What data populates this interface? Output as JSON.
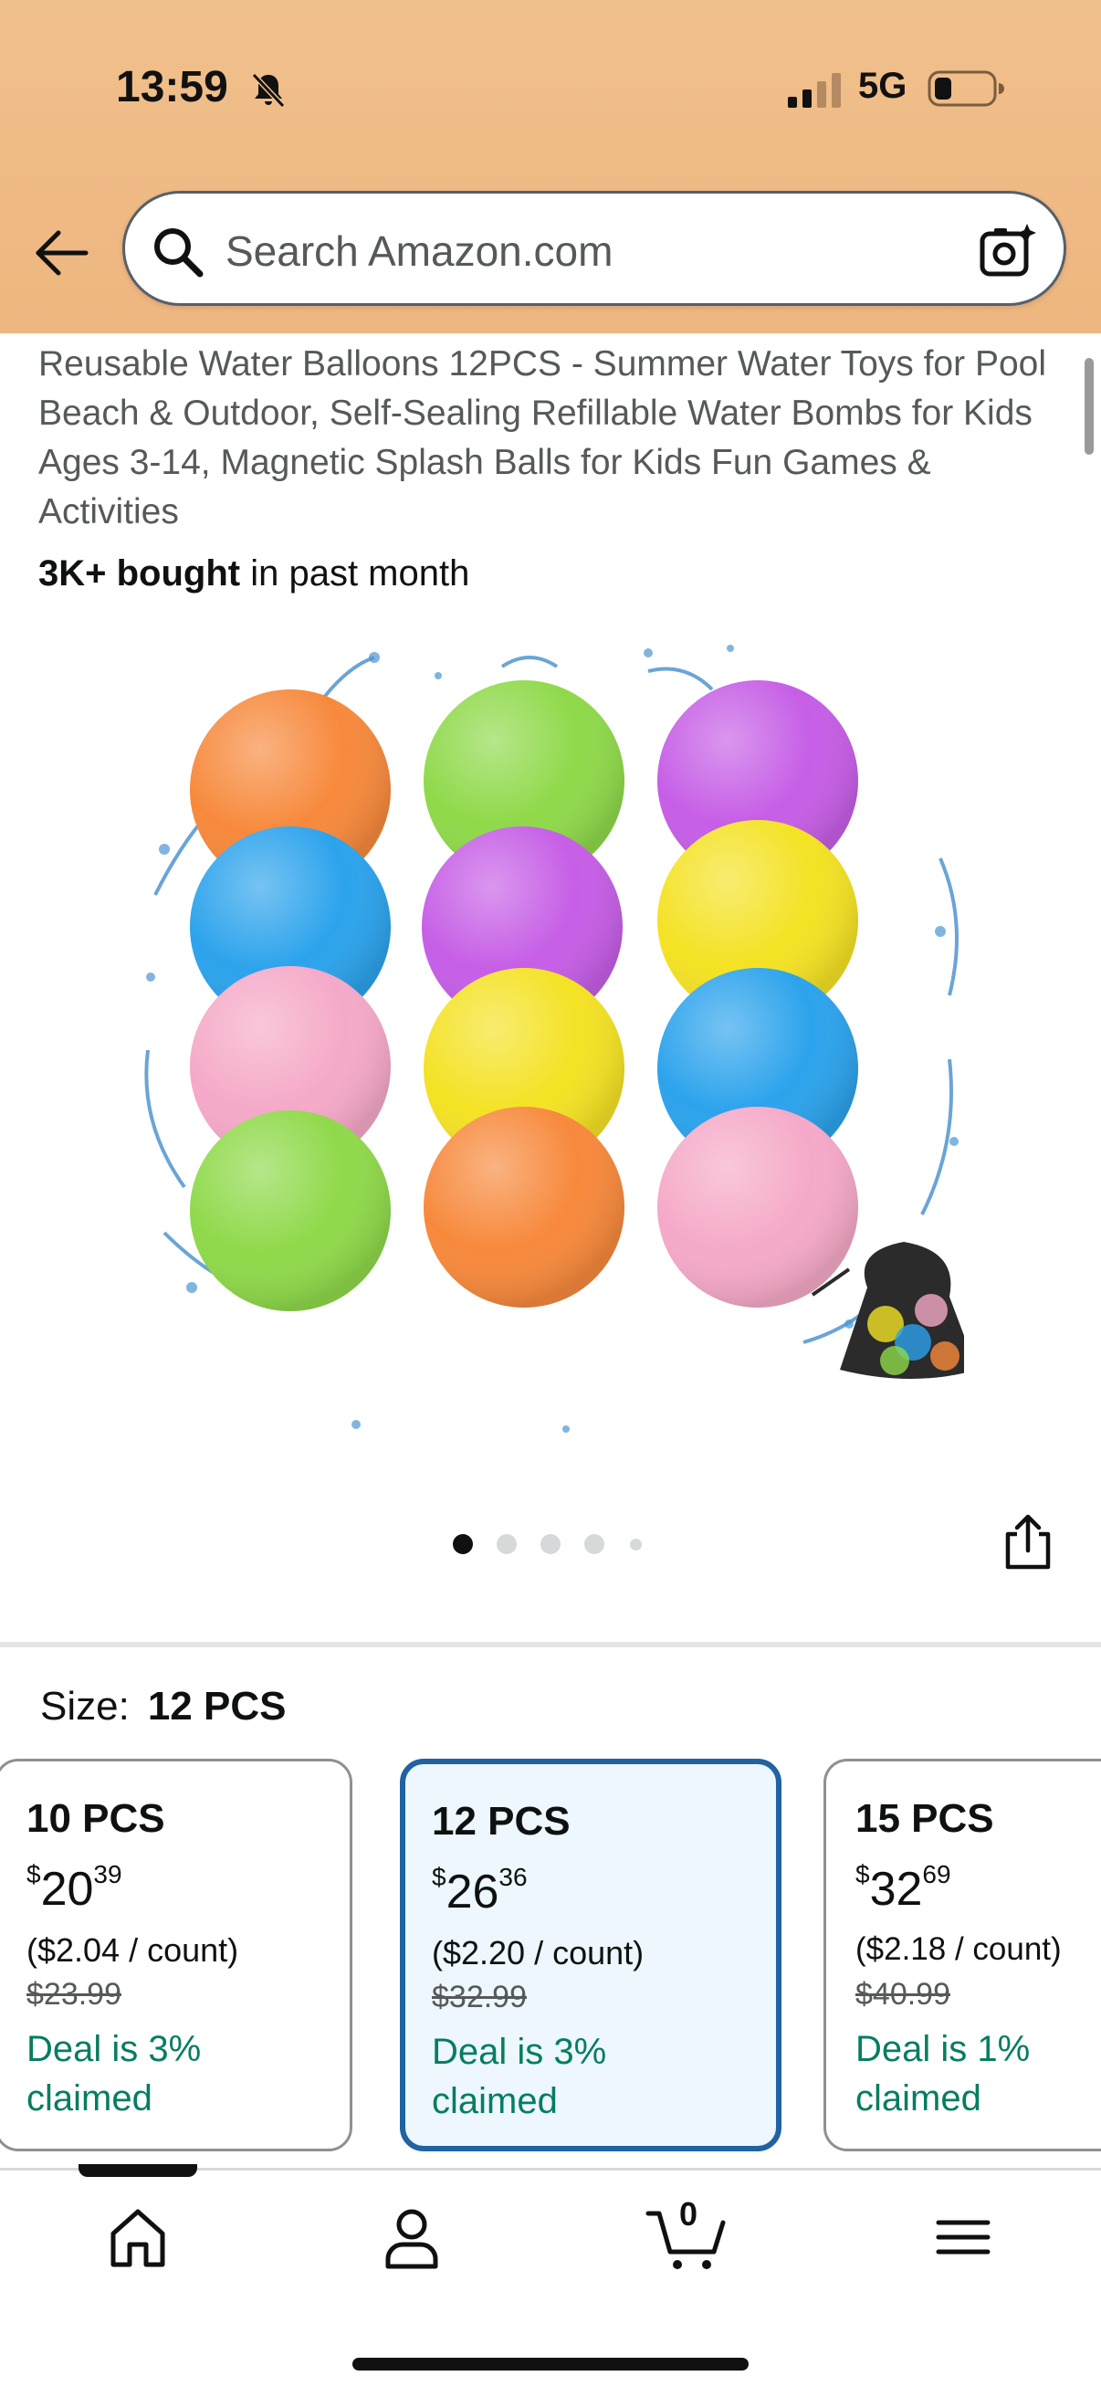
{
  "status_bar": {
    "time": "13:59",
    "network": "5G"
  },
  "search": {
    "placeholder": "Search Amazon.com"
  },
  "product": {
    "title": "Reusable Water Balloons 12PCS - Summer Water Toys for Pool Beach & Outdoor, Self-Sealing Refillable Water Bombs for Kids Ages 3-14, Magnetic Splash Balls for Kids Fun Games & Activities",
    "bought_bold": "3K+ bought",
    "bought_rest": " in past month",
    "image_count": 5,
    "current_image": 1
  },
  "size": {
    "label": "Size:",
    "selected": "12 PCS"
  },
  "size_options": [
    {
      "name": "10 PCS",
      "price_symbol": "$",
      "price_whole": "20",
      "price_fraction": "39",
      "unit_price": "($2.04 / count)",
      "list_price": "$23.99",
      "deal": "Deal is 3% claimed",
      "selected": false
    },
    {
      "name": "12 PCS",
      "price_symbol": "$",
      "price_whole": "26",
      "price_fraction": "36",
      "unit_price": "($2.20 / count)",
      "list_price": "$32.99",
      "deal": "Deal is 3% claimed",
      "selected": true
    },
    {
      "name": "15 PCS",
      "price_symbol": "$",
      "price_whole": "32",
      "price_fraction": "69",
      "unit_price": "($2.18 / count)",
      "list_price": "$40.99",
      "deal": "Deal is 1% claimed",
      "selected": false
    }
  ],
  "bottom_nav": {
    "cart_count": "0"
  },
  "colors": {
    "header": "#eeb67f",
    "selected_border": "#2162a1",
    "deal": "#067d62",
    "ball_orange": "#f7893c",
    "ball_green": "#8fd94a",
    "ball_purple": "#c65ee6",
    "ball_blue": "#2ca3ec",
    "ball_yellow": "#f4e224",
    "ball_pink": "#f5a9c8"
  }
}
